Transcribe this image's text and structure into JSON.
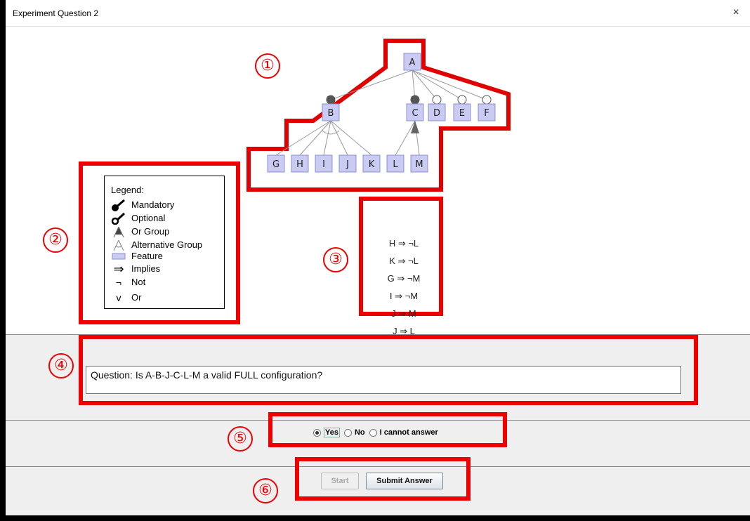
{
  "window": {
    "title": "Experiment Question 2",
    "close_icon": "close-icon",
    "close_glyph": "×"
  },
  "annotations": [
    "①",
    "②",
    "③",
    "④",
    "⑤",
    "⑥"
  ],
  "feature_model": {
    "root": "A",
    "level1": [
      "B",
      "C",
      "D",
      "E",
      "F"
    ],
    "level2": [
      "G",
      "H",
      "I",
      "J",
      "K",
      "L",
      "M"
    ],
    "mandatory": [
      "B",
      "C"
    ],
    "optional": [
      "D",
      "E",
      "F"
    ],
    "groups": [
      {
        "parent": "B",
        "type": "alternative",
        "children": [
          "G",
          "H",
          "I",
          "J",
          "K"
        ]
      },
      {
        "parent": "C",
        "type": "or",
        "children": [
          "L",
          "M"
        ]
      }
    ],
    "feature_color": "#c9cbf3",
    "feature_border": "#8a8fd0",
    "annotation_color": "#e00000"
  },
  "legend": {
    "title": "Legend:",
    "items": [
      {
        "icon": "mandatory-icon",
        "symbol": "",
        "label": "Mandatory"
      },
      {
        "icon": "optional-icon",
        "symbol": "",
        "label": "Optional"
      },
      {
        "icon": "or-group-icon",
        "symbol": "",
        "label": "Or Group"
      },
      {
        "icon": "alternative-group-icon",
        "symbol": "",
        "label": "Alternative Group"
      },
      {
        "icon": "feature-icon",
        "symbol": "",
        "label": "Feature"
      },
      {
        "icon": "implies-icon",
        "symbol": "⇒",
        "label": "Implies"
      },
      {
        "icon": "not-icon",
        "symbol": "¬",
        "label": "Not"
      },
      {
        "icon": "or-icon",
        "symbol": "v",
        "label": "Or"
      }
    ]
  },
  "constraints": [
    "H ⇒ ¬L",
    "K ⇒ ¬L",
    "G ⇒ ¬M",
    "I ⇒ ¬M",
    "J ⇒ M",
    "J ⇒ L"
  ],
  "question": {
    "text": "Question: Is A-B-J-C-L-M a valid FULL configuration?"
  },
  "answers": {
    "options": [
      "Yes",
      "No",
      "I cannot answer"
    ],
    "selected": "Yes"
  },
  "buttons": {
    "start_label": "Start",
    "submit_label": "Submit Answer"
  }
}
